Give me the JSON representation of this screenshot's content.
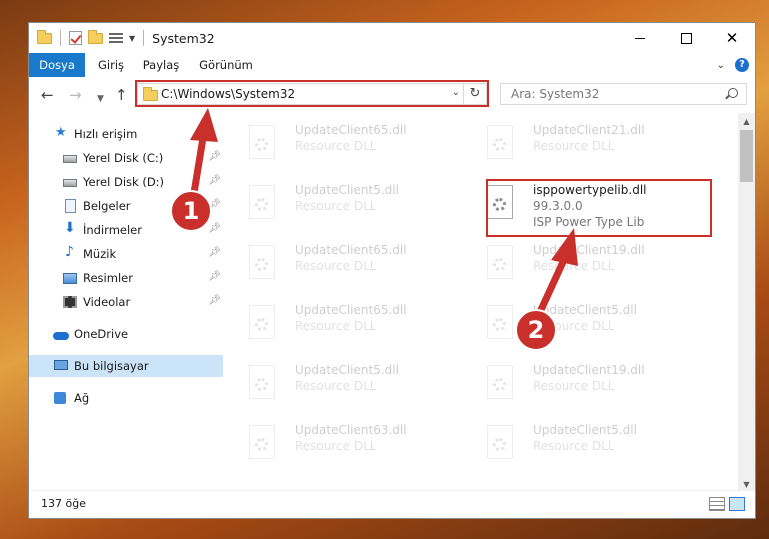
{
  "window": {
    "title": "System32"
  },
  "ribbon": {
    "tabs": [
      {
        "label": "Dosya"
      },
      {
        "label": "Giriş"
      },
      {
        "label": "Paylaş"
      },
      {
        "label": "Görünüm"
      }
    ],
    "help_label": "?"
  },
  "nav": {
    "address": "C:\\Windows\\System32",
    "search_placeholder": "Ara: System32"
  },
  "sidebar": {
    "items": [
      {
        "label": "Hızlı erişim",
        "icon": "star-icon"
      },
      {
        "label": "Yerel Disk (C:)",
        "icon": "disk-icon",
        "pinned": true
      },
      {
        "label": "Yerel Disk (D:)",
        "icon": "disk-icon",
        "pinned": true
      },
      {
        "label": "Belgeler",
        "icon": "document-icon",
        "pinned": true
      },
      {
        "label": "İndirmeler",
        "icon": "download-icon",
        "pinned": true
      },
      {
        "label": "Müzik",
        "icon": "music-icon",
        "pinned": true
      },
      {
        "label": "Resimler",
        "icon": "pictures-icon",
        "pinned": true
      },
      {
        "label": "Videolar",
        "icon": "videos-icon",
        "pinned": true
      },
      {
        "label": "OneDrive",
        "icon": "cloud-icon"
      },
      {
        "label": "Bu bilgisayar",
        "icon": "computer-icon",
        "selected": true
      },
      {
        "label": "Ağ",
        "icon": "network-icon"
      }
    ]
  },
  "files": [
    {
      "name": "UpdateClient65.dll",
      "line1": "Resource DLL",
      "line2": ""
    },
    {
      "name": "UpdateClient21.dll",
      "line1": "Resource DLL",
      "line2": ""
    },
    {
      "name": "UpdateClient5.dll",
      "line1": "Resource DLL",
      "line2": ""
    },
    {
      "name": "isppowertypelib.dll",
      "line1": "99.3.0.0",
      "line2": "ISP Power Type Lib",
      "highlighted": true
    },
    {
      "name": "UpdateClient65.dll",
      "line1": "Resource DLL",
      "line2": ""
    },
    {
      "name": "UpdateClient19.dll",
      "line1": "Resource DLL",
      "line2": ""
    },
    {
      "name": "UpdateClient65.dll",
      "line1": "Resource DLL",
      "line2": ""
    },
    {
      "name": "UpdateClient5.dll",
      "line1": "Resource DLL",
      "line2": ""
    },
    {
      "name": "UpdateClient5.dll",
      "line1": "Resource DLL",
      "line2": ""
    },
    {
      "name": "UpdateClient19.dll",
      "line1": "Resource DLL",
      "line2": ""
    },
    {
      "name": "UpdateClient63.dll",
      "line1": "Resource DLL",
      "line2": ""
    },
    {
      "name": "UpdateClient5.dll",
      "line1": "Resource DLL",
      "line2": ""
    }
  ],
  "status": {
    "item_count": "137 öğe"
  },
  "callouts": [
    {
      "label": "1"
    },
    {
      "label": "2"
    }
  ],
  "colors": {
    "accent": "#1979ca",
    "highlight": "#c9302c",
    "selection": "#cce4f7"
  }
}
